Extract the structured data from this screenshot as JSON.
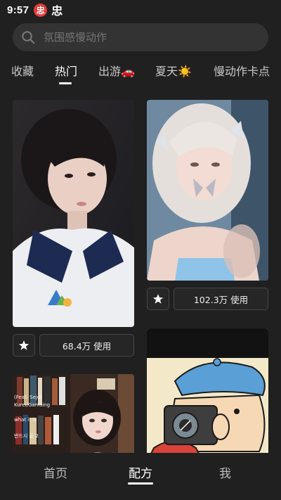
{
  "status_bar": {
    "time": "9:57",
    "badge_text": "忠",
    "app_glyph": "忠"
  },
  "search": {
    "placeholder": "氛围感慢动作",
    "icon": "search-icon"
  },
  "tabs": [
    {
      "label": "收藏",
      "active": false
    },
    {
      "label": "热门",
      "active": true
    },
    {
      "label": "出游🚗",
      "active": false
    },
    {
      "label": "夏天☀️",
      "active": false
    },
    {
      "label": "慢动作卡点",
      "active": false
    }
  ],
  "feed": {
    "cards": [
      {
        "image": "portrait-girl-school-uniform",
        "usage": "68.4万 使用",
        "favorite_icon": "star-icon"
      },
      {
        "image": "portrait-girl-silver-hair",
        "usage": "102.3万 使用",
        "favorite_icon": "star-icon"
      },
      {
        "image": "portrait-girl-bookshelf",
        "overlay_lines": [
          "(Feat. Sejo)",
          "Kurei/Gamsing",
          "what it is",
          "반드시 울 2"
        ]
      },
      {
        "image": "cartoon-boy-camera"
      }
    ]
  },
  "bottom_nav": {
    "items": [
      {
        "label": "首页",
        "active": false
      },
      {
        "label": "配方",
        "active": true
      },
      {
        "label": "我",
        "active": false
      }
    ]
  },
  "colors": {
    "background": "#202020",
    "search_bg": "#333333",
    "card_border": "#474747",
    "badge_red": "#e23b3b"
  }
}
